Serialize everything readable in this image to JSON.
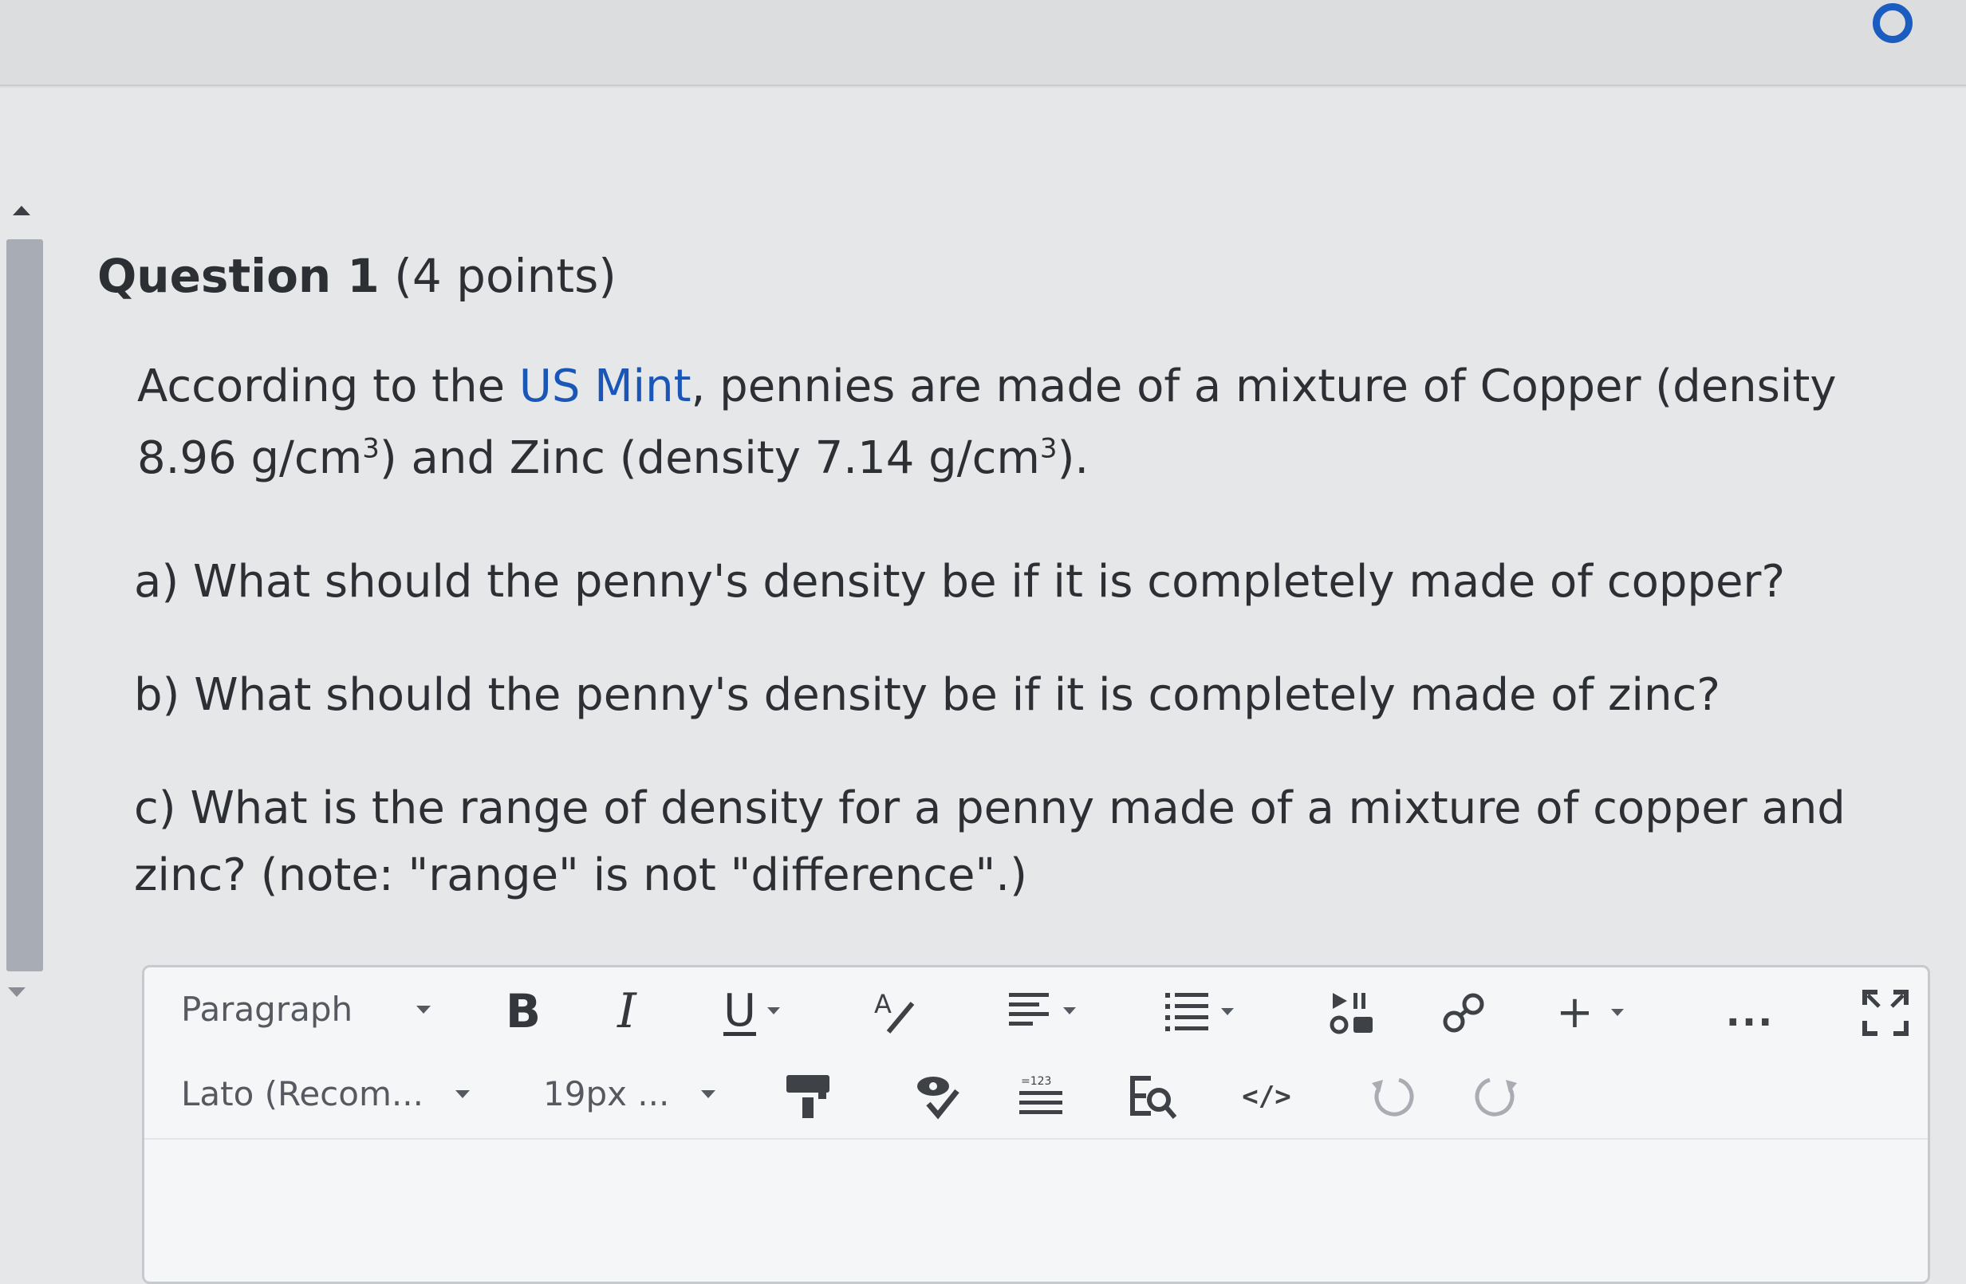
{
  "question": {
    "label": "Question 1",
    "points": "(4 points)"
  },
  "prompt": {
    "intro_before_link": "According to the ",
    "link_text": "US Mint",
    "intro_after_link": ", pennies are made of a mixture of Copper (density 8.96 g/cm",
    "sup1": "3",
    "middle": ") and Zinc (density 7.14 g/cm",
    "sup2": "3",
    "end": ")."
  },
  "parts": {
    "a": "a) What should the penny's density be if it is completely made of copper?",
    "b": "b) What should the penny's density be if it is completely made of zinc?",
    "c": "c) What is the range of density for a penny made of a mixture of copper and zinc? (note: \"range\" is not \"difference\".)"
  },
  "toolbar": {
    "paragraph_select": "Paragraph",
    "bold_label": "B",
    "italic_label": "I",
    "underline_label": "U",
    "more_label": "...",
    "font_select": "Lato (Recom...",
    "size_select": "19px ...",
    "code_label": "</>"
  },
  "colors": {
    "accent": "#1a5cbf",
    "link": "#1a56b8",
    "page_background": "#e6e7e8",
    "editor_background": "#f5f6f7"
  },
  "icons": [
    "status-ring-icon",
    "chevron-down-icon",
    "text-style-icon",
    "align-icon",
    "list-icon",
    "media-icon",
    "link-icon",
    "plus-icon",
    "fullscreen-icon",
    "format-painter-icon",
    "accessibility-check-icon",
    "word-count-icon",
    "find-replace-icon",
    "undo-icon",
    "redo-icon"
  ]
}
